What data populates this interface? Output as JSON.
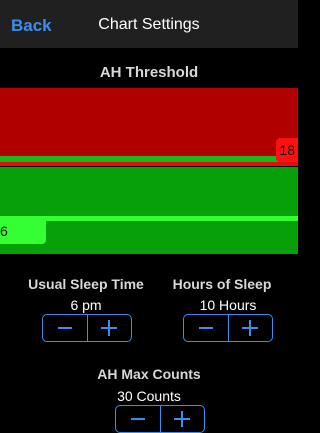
{
  "nav": {
    "back_label": "Back",
    "title": "Chart Settings"
  },
  "threshold": {
    "title": "AH Threshold",
    "upper_value": "18",
    "lower_value": "6",
    "colors": {
      "upper_zone": "#b00000",
      "lower_zone": "#08a008",
      "upper_handle": "#ff1010",
      "lower_handle": "#33ff33"
    }
  },
  "settings": {
    "sleep_time": {
      "label": "Usual Sleep Time",
      "value": "6 pm"
    },
    "hours_of_sleep": {
      "label": "Hours of Sleep",
      "value": "10 Hours"
    },
    "ah_max_counts": {
      "label": "AH Max Counts",
      "value": "30 Counts"
    }
  },
  "accent_color": "#3b8ef0"
}
